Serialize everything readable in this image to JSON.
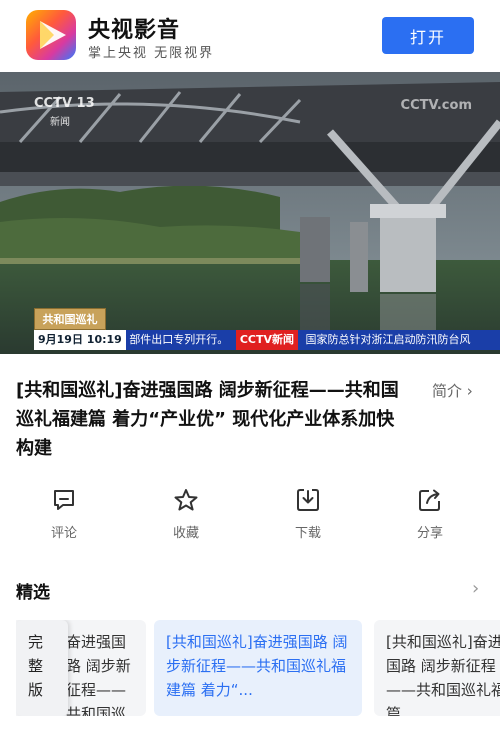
{
  "app": {
    "name": "央视影音",
    "slogan": "掌上央视 无限视界",
    "open_label": "打开"
  },
  "video": {
    "channel_logo": "CCTV 13",
    "channel_sub": "新闻",
    "watermark": "CCTV.com",
    "program_tag": "共和国巡礼",
    "ticker_date": "9月19日 10:19",
    "ticker_left": "部件出口专列开行。",
    "ticker_channel": "CCTV新闻",
    "ticker_right": "国家防总针对浙江启动防汛防台风"
  },
  "title": "[共和国巡礼]奋进强国路 阔步新征程——共和国巡礼福建篇 着力“产业优” 现代化产业体系加快构建",
  "intro_label": "简介 ›",
  "actions": {
    "comment": "评论",
    "favorite": "收藏",
    "download": "下载",
    "share": "分享"
  },
  "featured": {
    "title": "精选",
    "arrow": "›",
    "full_label": "完整版",
    "cards": [
      {
        "text": "奋进强国路 阔步新征程——共和国巡礼福建篇 着力“..."
      },
      {
        "text": "[共和国巡礼]奋进强国路 阔步新征程——共和国巡礼福建篇 着力“..."
      },
      {
        "text": "[共和国巡礼]奋进强国路 阔步新征程——共和国巡礼福建篇"
      }
    ]
  },
  "colors": {
    "accent": "#2b6ff2",
    "ticker": "#1a3ea8"
  }
}
